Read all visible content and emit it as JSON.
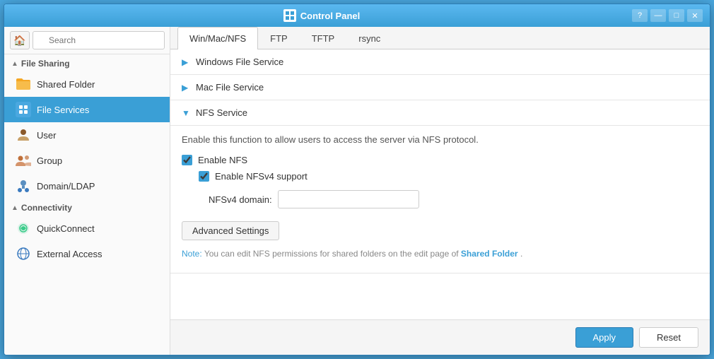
{
  "window": {
    "title": "Control Panel",
    "icon": "📋"
  },
  "titlebar": {
    "help_btn": "?",
    "minimize_btn": "—",
    "maximize_btn": "□",
    "close_btn": "✕"
  },
  "sidebar": {
    "search_placeholder": "Search",
    "home_icon": "🏠",
    "sections": [
      {
        "id": "file-sharing",
        "label": "File Sharing",
        "expanded": true
      },
      {
        "id": "connectivity",
        "label": "Connectivity",
        "expanded": true
      }
    ],
    "items": [
      {
        "id": "shared-folder",
        "label": "Shared Folder",
        "icon": "folder",
        "section": "file-sharing",
        "active": false
      },
      {
        "id": "file-services",
        "label": "File Services",
        "icon": "file-services",
        "section": "file-sharing",
        "active": true
      },
      {
        "id": "user",
        "label": "User",
        "icon": "user",
        "section": "file-sharing",
        "active": false
      },
      {
        "id": "group",
        "label": "Group",
        "icon": "group",
        "section": "file-sharing",
        "active": false
      },
      {
        "id": "domain-ldap",
        "label": "Domain/LDAP",
        "icon": "domain",
        "section": "file-sharing",
        "active": false
      },
      {
        "id": "quickconnect",
        "label": "QuickConnect",
        "icon": "quickconnect",
        "section": "connectivity",
        "active": false
      },
      {
        "id": "external-access",
        "label": "External Access",
        "icon": "external",
        "section": "connectivity",
        "active": false
      }
    ]
  },
  "tabs": [
    {
      "id": "win-mac-nfs",
      "label": "Win/Mac/NFS",
      "active": true
    },
    {
      "id": "ftp",
      "label": "FTP",
      "active": false
    },
    {
      "id": "tftp",
      "label": "TFTP",
      "active": false
    },
    {
      "id": "rsync",
      "label": "rsync",
      "active": false
    }
  ],
  "sections": {
    "windows_file_service": {
      "label": "Windows File Service",
      "expanded": false
    },
    "mac_file_service": {
      "label": "Mac File Service",
      "expanded": false
    },
    "nfs_service": {
      "label": "NFS Service",
      "expanded": true,
      "description": "Enable this function to allow users to access the server via NFS protocol.",
      "enable_nfs_label": "Enable NFS",
      "enable_nfs_checked": true,
      "enable_nfsv4_label": "Enable NFSv4 support",
      "enable_nfsv4_checked": true,
      "nfsv4_domain_label": "NFSv4 domain:",
      "nfsv4_domain_value": "",
      "advanced_settings_label": "Advanced Settings",
      "note_prefix": "Note:",
      "note_text": " You can edit NFS permissions for shared folders on the edit page of ",
      "note_link": "Shared Folder",
      "note_suffix": "."
    }
  },
  "footer": {
    "apply_label": "Apply",
    "reset_label": "Reset"
  }
}
